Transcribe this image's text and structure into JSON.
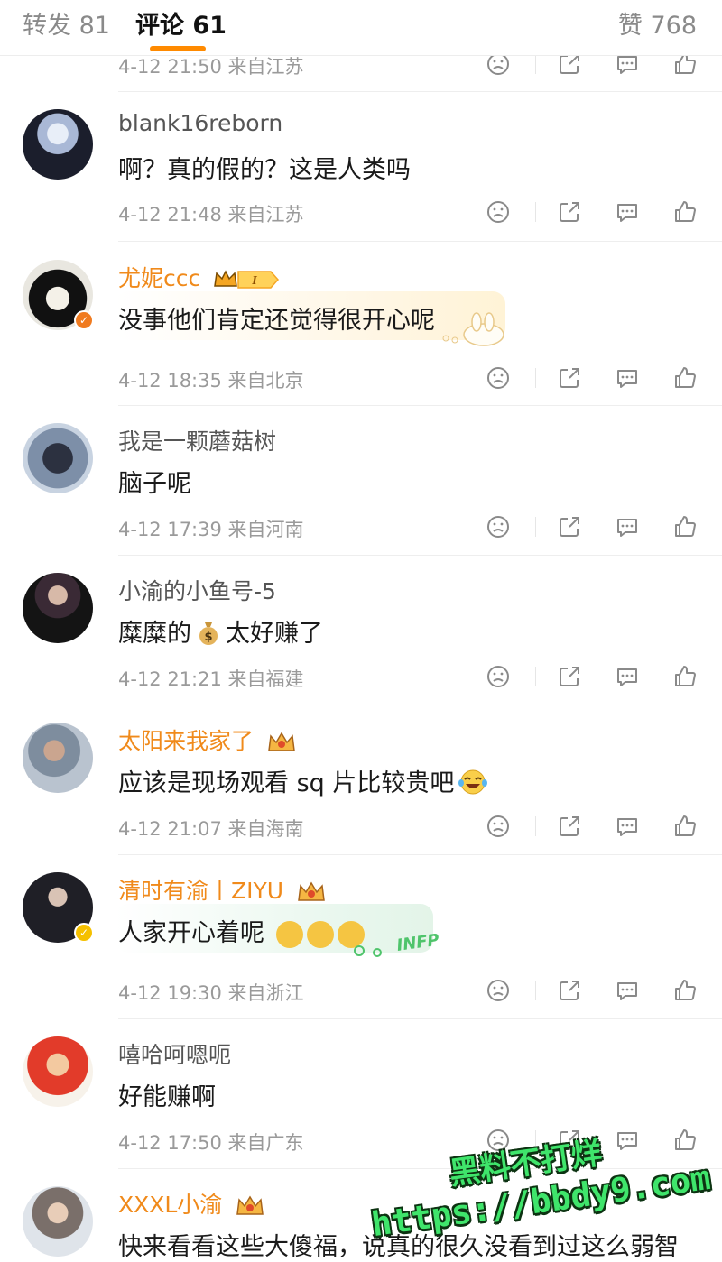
{
  "tabs": {
    "repost": "转发 81",
    "comments": "评论 61",
    "likes": "赞 768"
  },
  "top_partial_meta": "4-12 21:50 来自江苏",
  "comments": [
    {
      "name": "blank16reborn",
      "text": "啊？真的假的？这是人类吗",
      "meta": "4-12 21:48 来自江苏"
    },
    {
      "name": "尤妮ccc",
      "text": "没事他们肯定还觉得很开心呢",
      "meta": "4-12 18:35 来自北京"
    },
    {
      "name": "我是一颗蘑菇树",
      "text": "脑子呢",
      "meta": "4-12 17:39 来自河南"
    },
    {
      "name": "小渝的小鱼号-5",
      "text_a": "糜糜的",
      "text_b": "太好赚了",
      "meta": "4-12 21:21 来自福建"
    },
    {
      "name": "太阳来我家了",
      "text": "应该是现场观看 sq 片比较贵吧",
      "meta": "4-12 21:07 来自海南"
    },
    {
      "name": "清时有渝丨ZIYU",
      "text": "人家开心着呢",
      "meta": "4-12 19:30 来自浙江"
    },
    {
      "name": "嘻哈呵嗯呃",
      "text": "好能赚啊",
      "meta": "4-12 17:50 来自广东"
    },
    {
      "name": "XXXL小渝",
      "text": "快来看看这些大傻福，说真的很久没看到过这么弱智"
    }
  ],
  "badge_texts": {
    "vip_level": "I"
  },
  "bubble_texts": {
    "infp": "INFP"
  },
  "watermark": {
    "line1": "黑料不打烊",
    "line2": "https://bbdy9.com"
  },
  "colors": {
    "accent": "#ff8a00",
    "vip_name": "#f08a1b",
    "watermark": "#3fe56b"
  },
  "icons": [
    "dislike-icon",
    "share-icon",
    "reply-icon",
    "like-icon"
  ]
}
